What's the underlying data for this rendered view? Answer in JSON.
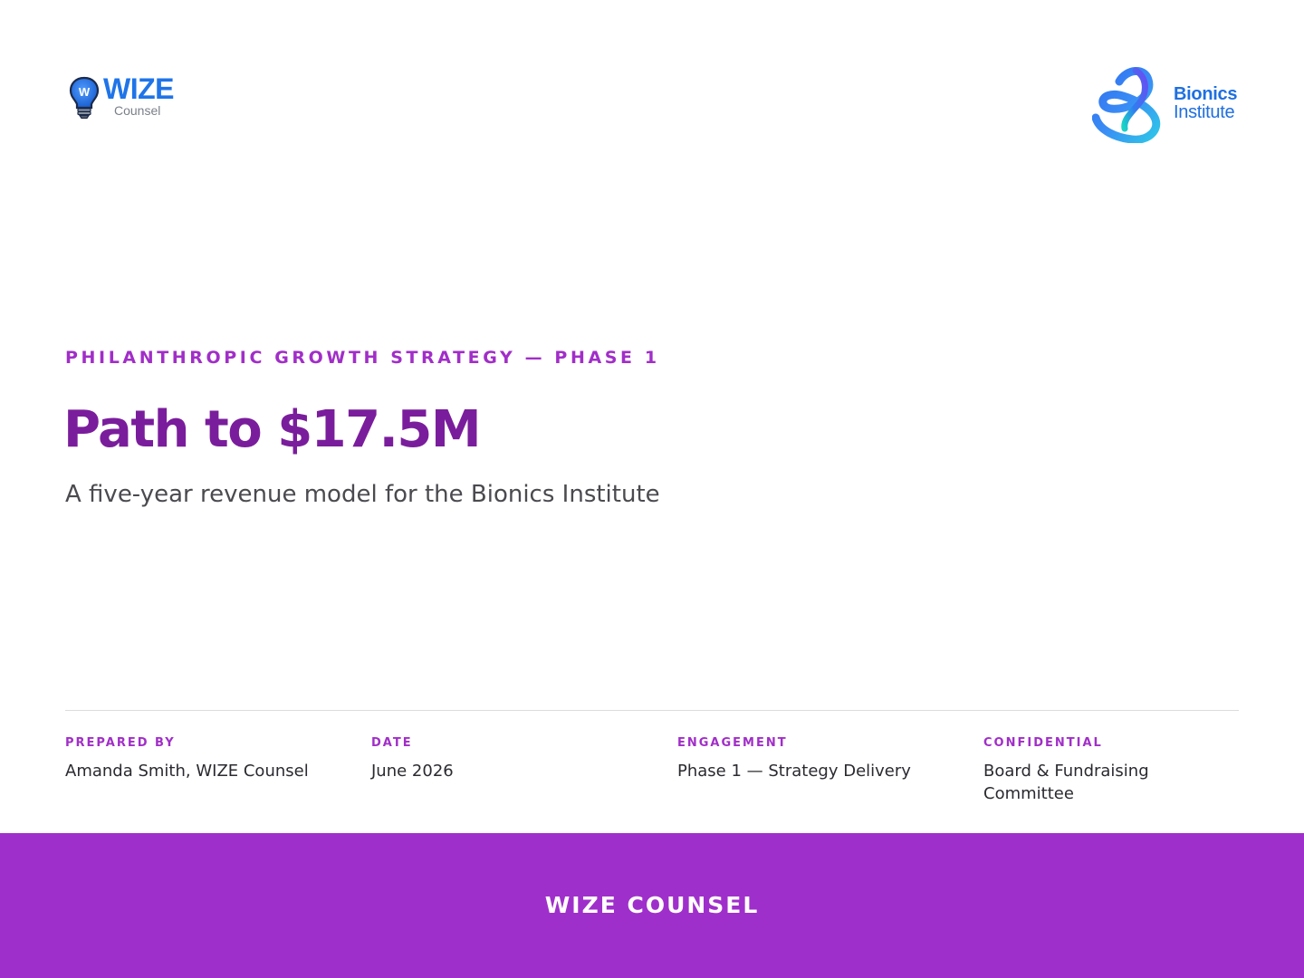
{
  "header": {
    "left_logo": {
      "icon": "lightbulb-icon",
      "mark_letter": "W",
      "wordmark": "WIZE",
      "subtext": "Counsel",
      "color": "#1f74e8"
    },
    "right_logo": {
      "icon": "bionics-ribbon-icon",
      "line1": "Bionics",
      "line2": "Institute",
      "color": "#1f6fe0"
    }
  },
  "hero": {
    "eyebrow": "PHILANTHROPIC GROWTH STRATEGY — PHASE 1",
    "title": "Path to $17.5M",
    "subtitle": "A five-year revenue model for the Bionics Institute"
  },
  "meta": [
    {
      "label": "PREPARED BY",
      "value": "Amanda Smith, WIZE Counsel"
    },
    {
      "label": "DATE",
      "value": "June 2026"
    },
    {
      "label": "ENGAGEMENT",
      "value": "Phase 1 — Strategy Delivery"
    },
    {
      "label": "CONFIDENTIAL",
      "value": "Board & Fundraising Committee"
    }
  ],
  "footer": {
    "text": "WIZE COUNSEL"
  },
  "colors": {
    "accent": "#a12ec8",
    "title": "#7a1d9c",
    "footer_band": "#9f2fcb",
    "brand_blue": "#1f74e8"
  }
}
